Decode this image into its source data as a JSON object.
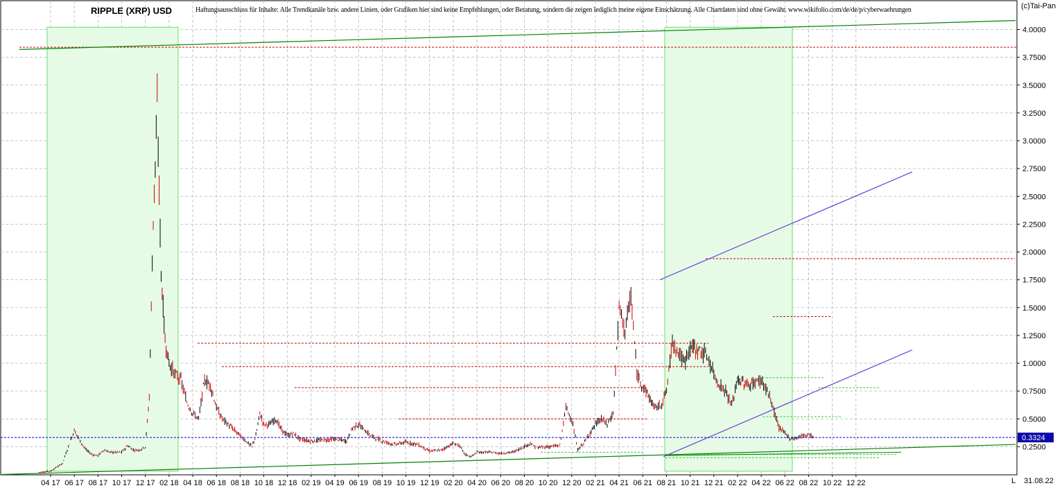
{
  "header": {
    "title": "RIPPLE (XRP) USD",
    "disclaimer": "Haftungsausschluss für Inhalte: Alle Trendkanäle bzw. andere Linien, oder Grafiken hier sind keine Empfehlungen, oder Beratung, sondern die zeigen lediglich meine eigene Einschätzung. Alle Chartdaten sind ohne Gewähr.  www.wikifolio.com/de/de/p/cyberwaehrungen",
    "copyright": "(c)Tai-Pan"
  },
  "footer": {
    "scale_mode": "L",
    "date": "31.08.22"
  },
  "colors": {
    "up_candle": "#000000",
    "down_candle": "#cc0000",
    "trend_line": "#008000",
    "channel_line": "#6a3dd8",
    "resistance_line": "#cc0000",
    "support_line": "#33cc33",
    "highlight_fill": "#e6fbe6",
    "current_price_line": "#0000cc"
  },
  "chart_data": {
    "type": "candlestick",
    "title": "RIPPLE (XRP) USD",
    "ylim": [
      0,
      4.1
    ],
    "y_ticks": [
      "0.2500",
      "0.5000",
      "0.7500",
      "1.0000",
      "1.2500",
      "1.5000",
      "1.7500",
      "2.0000",
      "2.2500",
      "2.5000",
      "2.7500",
      "3.0000",
      "3.2500",
      "3.5000",
      "3.7500",
      "4.0000"
    ],
    "x_ticks": [
      "04 17",
      "06 17",
      "08 17",
      "10 17",
      "12 17",
      "02 18",
      "04 18",
      "06 18",
      "08 18",
      "10 18",
      "12 18",
      "02 19",
      "04 19",
      "06 19",
      "08 19",
      "10 19",
      "12 19",
      "02 20",
      "04 20",
      "06 20",
      "08 20",
      "10 20",
      "12 20",
      "02 21",
      "04 21",
      "06 21",
      "08 21",
      "10 21",
      "12 21",
      "02 22",
      "04 22",
      "06 22",
      "08 22",
      "10 22",
      "12 22"
    ],
    "grid": true,
    "current_price": 0.3324,
    "current_price_label": "0.3324",
    "price_path": [
      [
        "03 17",
        0.02
      ],
      [
        "04 17",
        0.03
      ],
      [
        "05 17",
        0.1
      ],
      [
        "05 17",
        0.25
      ],
      [
        "06 17",
        0.4
      ],
      [
        "06 17",
        0.3
      ],
      [
        "07 17",
        0.22
      ],
      [
        "07 17",
        0.18
      ],
      [
        "08 17",
        0.17
      ],
      [
        "08 17",
        0.22
      ],
      [
        "09 17",
        0.2
      ],
      [
        "10 17",
        0.2
      ],
      [
        "10 17",
        0.26
      ],
      [
        "11 17",
        0.22
      ],
      [
        "11 17",
        0.22
      ],
      [
        "12 17",
        0.25
      ],
      [
        "12 17",
        0.7
      ],
      [
        "12 17",
        2.3
      ],
      [
        "01 18",
        3.3
      ],
      [
        "01 18",
        1.8
      ],
      [
        "01 18",
        1.2
      ],
      [
        "02 18",
        1.0
      ],
      [
        "02 18",
        0.9
      ],
      [
        "03 18",
        0.85
      ],
      [
        "03 18",
        0.65
      ],
      [
        "04 18",
        0.55
      ],
      [
        "04 18",
        0.5
      ],
      [
        "05 18",
        0.85
      ],
      [
        "05 18",
        0.8
      ],
      [
        "06 18",
        0.6
      ],
      [
        "06 18",
        0.5
      ],
      [
        "07 18",
        0.45
      ],
      [
        "08 18",
        0.35
      ],
      [
        "08 18",
        0.3
      ],
      [
        "09 18",
        0.25
      ],
      [
        "09 18",
        0.35
      ],
      [
        "09 18",
        0.55
      ],
      [
        "10 18",
        0.45
      ],
      [
        "10 18",
        0.45
      ],
      [
        "11 18",
        0.5
      ],
      [
        "11 18",
        0.4
      ],
      [
        "12 18",
        0.35
      ],
      [
        "12 18",
        0.37
      ],
      [
        "01 19",
        0.32
      ],
      [
        "02 19",
        0.3
      ],
      [
        "03 19",
        0.31
      ],
      [
        "04 19",
        0.32
      ],
      [
        "05 19",
        0.3
      ],
      [
        "05 19",
        0.42
      ],
      [
        "06 19",
        0.45
      ],
      [
        "06 19",
        0.4
      ],
      [
        "07 19",
        0.35
      ],
      [
        "08 19",
        0.3
      ],
      [
        "09 19",
        0.27
      ],
      [
        "10 19",
        0.29
      ],
      [
        "11 19",
        0.27
      ],
      [
        "12 19",
        0.21
      ],
      [
        "01 20",
        0.22
      ],
      [
        "02 20",
        0.28
      ],
      [
        "02 20",
        0.26
      ],
      [
        "03 20",
        0.18
      ],
      [
        "03 20",
        0.16
      ],
      [
        "04 20",
        0.2
      ],
      [
        "05 20",
        0.2
      ],
      [
        "06 20",
        0.19
      ],
      [
        "07 20",
        0.2
      ],
      [
        "08 20",
        0.25
      ],
      [
        "08 20",
        0.28
      ],
      [
        "09 20",
        0.24
      ],
      [
        "10 20",
        0.25
      ],
      [
        "11 20",
        0.26
      ],
      [
        "11 20",
        0.6
      ],
      [
        "12 20",
        0.5
      ],
      [
        "12 20",
        0.22
      ],
      [
        "01 21",
        0.28
      ],
      [
        "02 21",
        0.45
      ],
      [
        "02 21",
        0.5
      ],
      [
        "03 21",
        0.45
      ],
      [
        "03 21",
        0.55
      ],
      [
        "04 21",
        1.5
      ],
      [
        "04 21",
        1.3
      ],
      [
        "05 21",
        1.6
      ],
      [
        "05 21",
        0.9
      ],
      [
        "06 21",
        0.8
      ],
      [
        "07 21",
        0.6
      ],
      [
        "07 21",
        0.62
      ],
      [
        "08 21",
        0.75
      ],
      [
        "08 21",
        1.2
      ],
      [
        "09 21",
        1.1
      ],
      [
        "09 21",
        1.0
      ],
      [
        "10 21",
        1.15
      ],
      [
        "11 21",
        1.1
      ],
      [
        "11 21",
        1.05
      ],
      [
        "12 21",
        0.9
      ],
      [
        "12 21",
        0.8
      ],
      [
        "01 22",
        0.75
      ],
      [
        "01 22",
        0.62
      ],
      [
        "02 22",
        0.85
      ],
      [
        "03 22",
        0.8
      ],
      [
        "03 22",
        0.83
      ],
      [
        "04 22",
        0.85
      ],
      [
        "04 22",
        0.75
      ],
      [
        "05 22",
        0.6
      ],
      [
        "05 22",
        0.42
      ],
      [
        "06 22",
        0.37
      ],
      [
        "06 22",
        0.32
      ],
      [
        "07 22",
        0.33
      ],
      [
        "07 22",
        0.35
      ],
      [
        "08 22",
        0.36
      ],
      [
        "08 22",
        0.3324
      ]
    ]
  }
}
